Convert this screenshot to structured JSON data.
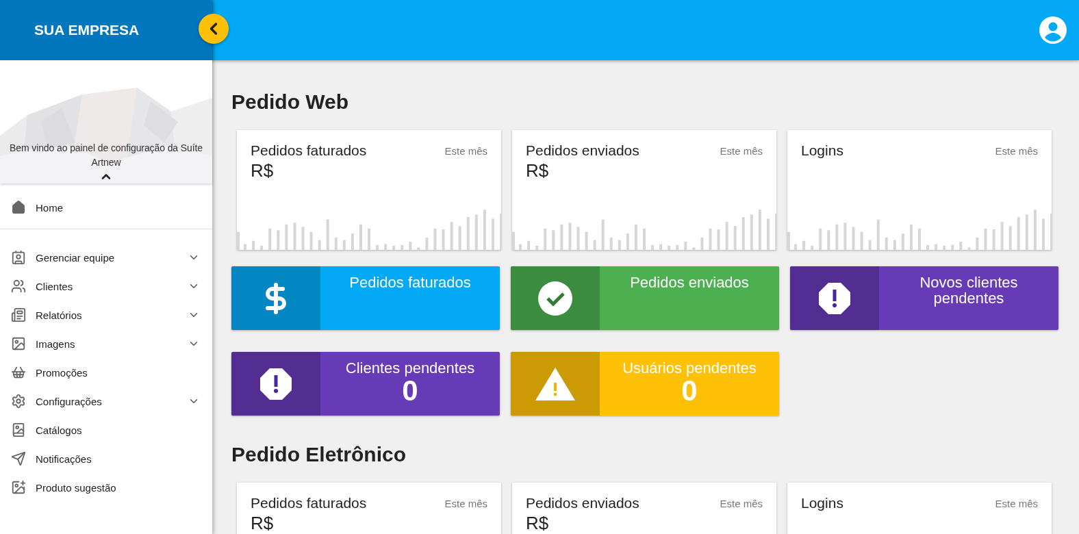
{
  "sidebar": {
    "brand": "SUA EMPRESA",
    "welcome": "Bem vindo ao painel de configuração da Suíte Artnew",
    "home": {
      "label": "Home"
    },
    "items": [
      {
        "label": "Gerenciar equipe",
        "has_submenu": true
      },
      {
        "label": "Clientes",
        "has_submenu": true
      },
      {
        "label": "Relatórios",
        "has_submenu": true
      },
      {
        "label": "Imagens",
        "has_submenu": true
      },
      {
        "label": "Promoções",
        "has_submenu": false
      },
      {
        "label": "Configurações",
        "has_submenu": true
      },
      {
        "label": "Catálogos",
        "has_submenu": false
      },
      {
        "label": "Notificações",
        "has_submenu": false
      },
      {
        "label": "Produto sugestão",
        "has_submenu": false
      }
    ]
  },
  "sections": [
    {
      "title": "Pedido Web",
      "cards": [
        {
          "title": "Pedidos faturados",
          "period": "Este mês",
          "value": "R$"
        },
        {
          "title": "Pedidos enviados",
          "period": "Este mês",
          "value": "R$"
        },
        {
          "title": "Logins",
          "period": "Este mês"
        }
      ],
      "tiles": [
        {
          "kind": "money",
          "title": "Pedidos faturados",
          "color": "#03a9f4"
        },
        {
          "kind": "check",
          "title": "Pedidos enviados",
          "color": "#4caf50"
        },
        {
          "kind": "alert",
          "title": "Novos clientes pendentes",
          "color": "#673ab7"
        },
        {
          "kind": "alert",
          "title": "Clientes pendentes",
          "value": "0",
          "color": "#673ab7"
        },
        {
          "kind": "warning",
          "title": "Usuários pendentes",
          "value": "0",
          "color": "#ffc107"
        }
      ]
    },
    {
      "title": "Pedido Eletrônico",
      "cards": [
        {
          "title": "Pedidos faturados",
          "period": "Este mês",
          "value": "R$"
        },
        {
          "title": "Pedidos enviados",
          "period": "Este mês",
          "value": "R$"
        },
        {
          "title": "Logins",
          "period": "Este mês"
        }
      ]
    }
  ]
}
